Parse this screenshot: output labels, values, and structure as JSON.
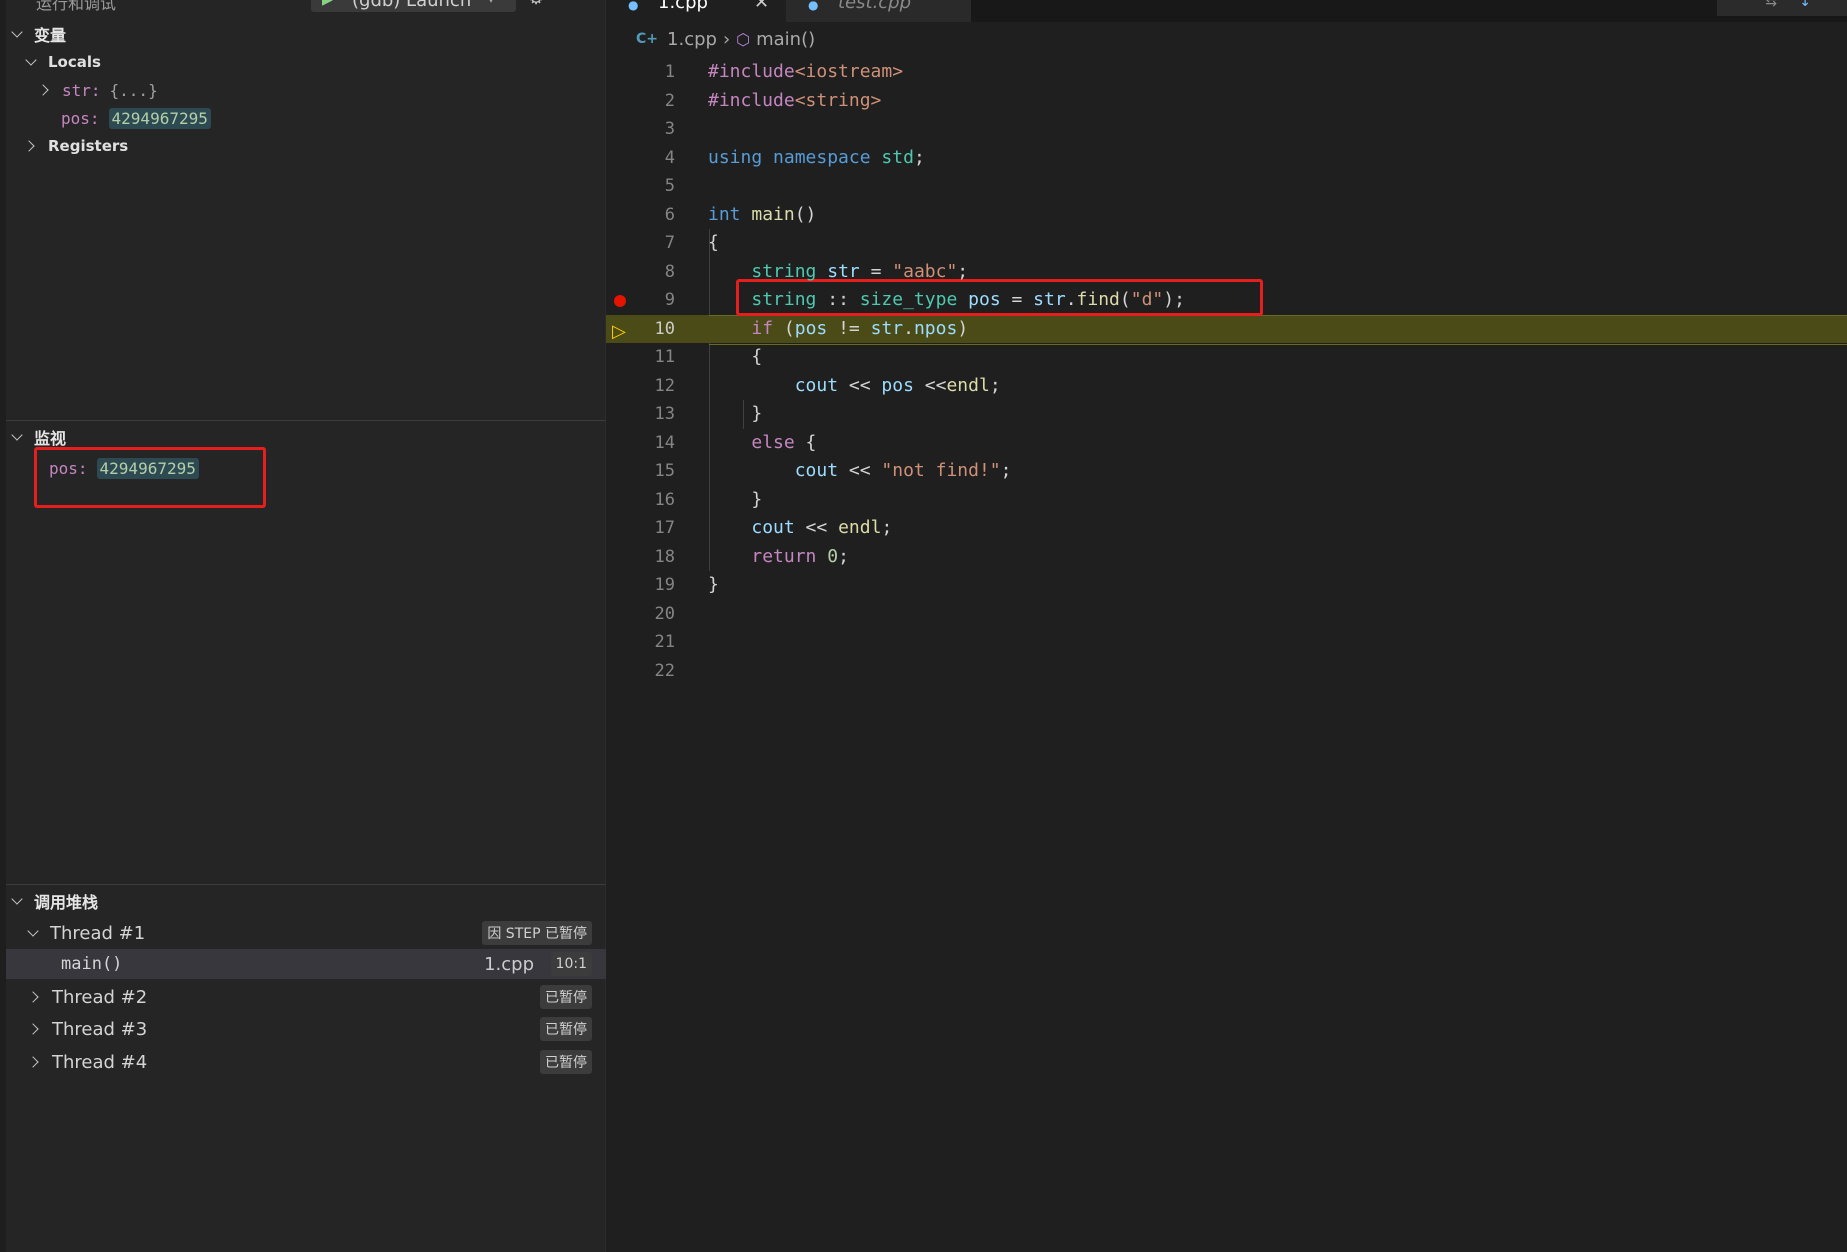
{
  "top_bar": {
    "title": "运行和调试",
    "config": "(gdb) Launch"
  },
  "variables": {
    "header": "变量",
    "locals_label": "Locals",
    "str_name": "str:",
    "str_value": "{...}",
    "pos_name": "pos:",
    "pos_value": "4294967295",
    "registers_label": "Registers"
  },
  "watch": {
    "header": "监视",
    "pos_name": "pos:",
    "pos_value": "4294967295"
  },
  "call_stack": {
    "header": "调用堆栈",
    "thread1": {
      "label": "Thread #1",
      "status": "因 STEP 已暂停"
    },
    "frame": {
      "name": "main()",
      "file": "1.cpp",
      "loc": "10:1"
    },
    "thread2": {
      "label": "Thread #2",
      "status": "已暂停"
    },
    "thread3": {
      "label": "Thread #3",
      "status": "已暂停"
    },
    "thread4": {
      "label": "Thread #4",
      "status": "已暂停"
    }
  },
  "tabs": {
    "active": "1.cpp",
    "inactive": "test.cpp"
  },
  "breadcrumb": {
    "file": "1.cpp",
    "symbol": "main()"
  },
  "editor": {
    "line_numbers": [
      "1",
      "2",
      "3",
      "4",
      "5",
      "6",
      "7",
      "8",
      "9",
      "10",
      "11",
      "12",
      "13",
      "14",
      "15",
      "16",
      "17",
      "18",
      "19",
      "20",
      "21",
      "22"
    ],
    "tokens": {
      "inc1_kw": "#include",
      "inc1_hdr": "<iostream>",
      "inc2_kw": "#include",
      "inc2_hdr": "<string>",
      "l4_using": "using",
      "l4_ns": "namespace",
      "l4_std": "std",
      "l4_semi": ";",
      "l6_int": "int",
      "l6_main": "main",
      "l6_parens": "()",
      "l7": "{",
      "l8_type": "string",
      "l8_var": "str",
      "l8_eq": " = ",
      "l8_str": "\"aabc\"",
      "l8_semi": ";",
      "l9_type": "string",
      "l9_sep": " :: ",
      "l9_type2": "size_type",
      "l9_var": "pos",
      "l9_eq": " = ",
      "l9_obj": "str",
      "l9_dot": ".",
      "l9_fn": "find",
      "l9_open": "(",
      "l9_str": "\"d\"",
      "l9_close": ");",
      "l10_if": "if",
      "l10_open": " (",
      "l10_pos": "pos",
      "l10_ne": " != ",
      "l10_str": "str",
      "l10_dot": ".",
      "l10_npos": "npos",
      "l10_close": ")",
      "l11": "{",
      "l12_cout": "cout",
      "l12_op": " << ",
      "l12_pos": "pos",
      "l12_op2": " <<",
      "l12_endl": "endl",
      "l12_semi": ";",
      "l13": "}",
      "l14_else": "else",
      "l14_brace": " {",
      "l15_cout": "cout",
      "l15_op": " << ",
      "l15_str": "\"not find!\"",
      "l15_semi": ";",
      "l16": "}",
      "l17_cout": "cout",
      "l17_op": " << ",
      "l17_endl": "endl",
      "l17_semi": ";",
      "l18_ret": "return",
      "l18_num": "0",
      "l18_semi": ";",
      "l19": "}"
    }
  },
  "colors": {
    "breakpoint": "#e51400",
    "current_line": "#4b4b18",
    "highlight_box": "#e51e1e"
  },
  "icons": [
    "chevron-down-icon",
    "chevron-right-icon",
    "breakpoint-icon",
    "current-line-arrow-icon",
    "cpp-file-icon",
    "symbol-method-icon",
    "gear-icon",
    "play-icon"
  ]
}
